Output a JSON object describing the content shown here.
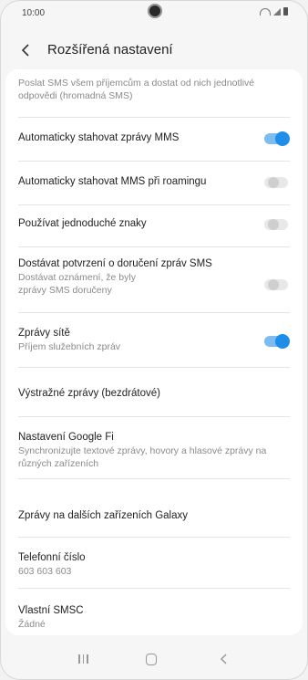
{
  "status_bar": {
    "time": "10:00"
  },
  "header": {
    "title": "Rozšířená nastavení"
  },
  "settings": {
    "group_sms": {
      "title": "Poslat SMS všem příjemcům a dostat od nich jednotlivé odpovědi (hromadná SMS)"
    },
    "auto_mms": {
      "title": "Automaticky stahovat zprávy MMS",
      "enabled": true
    },
    "auto_mms_roaming": {
      "title": "Automaticky stahovat MMS při roamingu",
      "enabled": false
    },
    "simple_chars": {
      "title": "Používat jednoduché znaky",
      "enabled": false
    },
    "delivery_reports": {
      "title": "Dostávat potvrzení o doručení zpráv SMS",
      "subtitle": "Dostávat oznámení, že byly zprávy SMS doručeny",
      "enabled": false
    },
    "network_messages": {
      "title": "Zprávy sítě",
      "subtitle": "Příjem služebních zpráv",
      "enabled": true
    },
    "emergency_alerts": {
      "title": "Výstražné zprávy (bezdrátové)"
    },
    "google_fi": {
      "title": "Nastavení Google Fi",
      "subtitle": "Synchronizujte textové zprávy, hovory a hlasové zprávy na různých zařízeních"
    },
    "other_devices": {
      "title": "Zprávy na dalších zařízeních Galaxy"
    },
    "phone_number": {
      "title": "Telefonní číslo",
      "value": "603 603 603"
    },
    "smsc": {
      "title": "Vlastní SMSC",
      "value": "Žádné"
    }
  },
  "icons": {
    "back": "chevron-left-icon",
    "nav_recent": "recent-apps-icon",
    "nav_home": "home-icon",
    "nav_back": "back-arrow-icon"
  },
  "colors": {
    "accent": "#1f8ee8",
    "toggle_track_on": "#7cbcf0",
    "toggle_off": "#cfcfcf"
  }
}
